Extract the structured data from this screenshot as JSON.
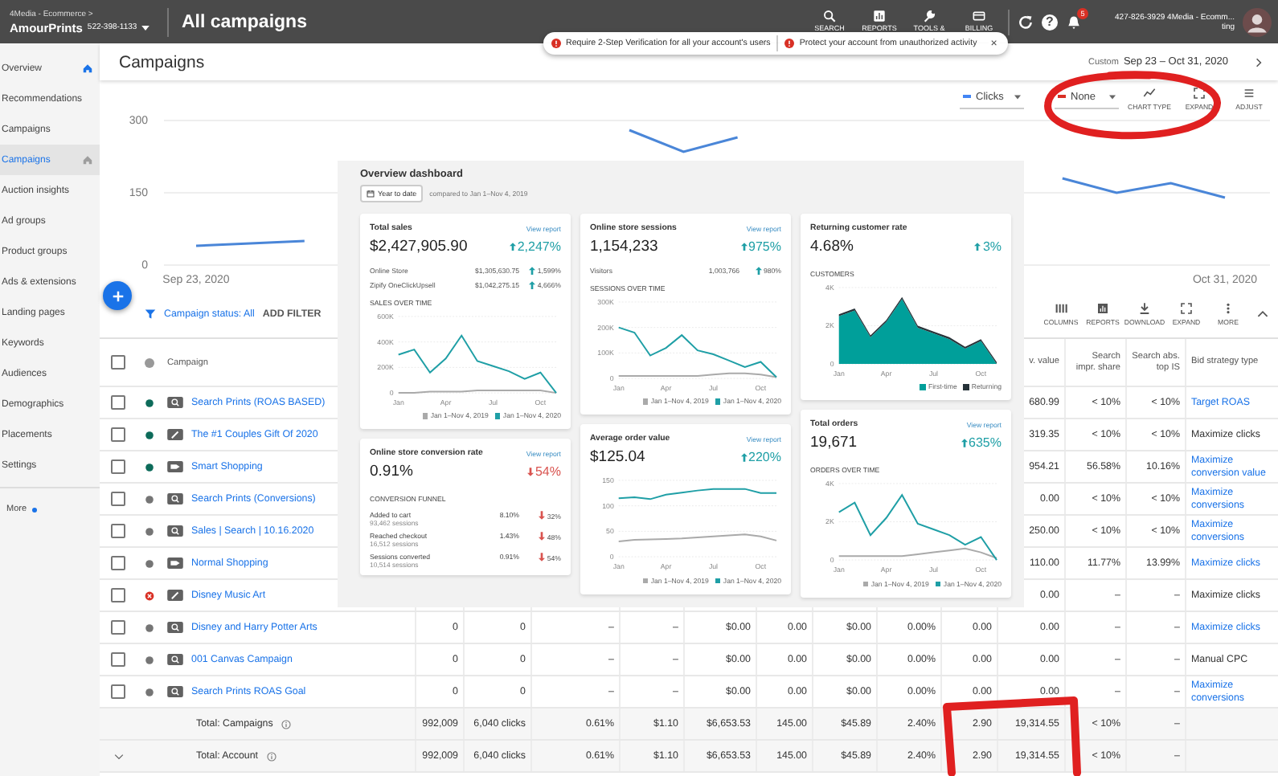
{
  "top_bar": {
    "breadcrumb": "4Media - Ecommerce >",
    "account_name": "AmourPrints",
    "account_id": "522-398-1133",
    "title": "All campaigns",
    "tools": [
      {
        "label": "SEARCH",
        "kind": "search"
      },
      {
        "label": "REPORTS",
        "kind": "reports"
      },
      {
        "label": "TOOLS &",
        "kind": "tools"
      },
      {
        "label": "BILLING",
        "kind": "billing"
      }
    ],
    "help": "?",
    "notification_count": "5",
    "account_line": "427-826-3929 4Media - Ecomm...",
    "account_line_2": "ting"
  },
  "alerts": {
    "items": [
      {
        "text": "Require 2-Step Verification for all your account's users"
      },
      {
        "text": "Protect your account from unauthorized activity"
      }
    ],
    "close": "×"
  },
  "sidebar": {
    "items": [
      {
        "label": "Overview",
        "selected": false,
        "home": true
      },
      {
        "label": "Recommendations",
        "selected": false,
        "home": false
      },
      {
        "label": "Campaigns",
        "selected": false,
        "home": false
      },
      {
        "label": "Campaigns",
        "selected": true,
        "home": true
      },
      {
        "label": "Auction insights",
        "selected": false,
        "home": false
      },
      {
        "label": "Ad groups",
        "selected": false,
        "home": false
      },
      {
        "label": "Product groups",
        "selected": false,
        "home": false
      },
      {
        "label": "Ads & extensions",
        "selected": false,
        "home": false
      },
      {
        "label": "Landing pages",
        "selected": false,
        "home": false
      },
      {
        "label": "Keywords",
        "selected": false,
        "home": false
      },
      {
        "label": "Audiences",
        "selected": false,
        "home": false
      },
      {
        "label": "Demographics",
        "selected": false,
        "home": false
      },
      {
        "label": "Placements",
        "selected": false,
        "home": false
      },
      {
        "label": "Settings",
        "selected": false,
        "home": false
      }
    ],
    "more": "More"
  },
  "page": {
    "title": "Campaigns",
    "date_prefix": "Custom",
    "date_range": "Sep 23 – Oct 31, 2020"
  },
  "chart_controls": {
    "metrics": [
      {
        "label": "Clicks",
        "color": "#4285f4"
      },
      {
        "label": "None",
        "color": "#d93025"
      }
    ],
    "actions": [
      {
        "label": "CHART TYPE",
        "kind": "chart"
      },
      {
        "label": "EXPAND",
        "kind": "expand"
      },
      {
        "label": "ADJUST",
        "kind": "adjust"
      }
    ]
  },
  "main_chart": {
    "chart_data": {
      "type": "line",
      "categories": [
        "Sep 23, 2020",
        null,
        null,
        null,
        null,
        null,
        null,
        null,
        null,
        null,
        null,
        null,
        null,
        null,
        null,
        null,
        null,
        null,
        null,
        "Oct 31, 2020"
      ],
      "ylim": [
        0,
        300
      ],
      "yticks": [
        0,
        150,
        300
      ],
      "series": [
        {
          "color": "#4a86d8",
          "values": [
            40,
            45,
            50,
            null,
            null,
            null,
            null,
            null,
            280,
            235,
            265,
            null,
            null,
            null,
            null,
            null,
            180,
            150,
            170,
            140
          ]
        }
      ]
    }
  },
  "filter": {
    "status": "Campaign status: All",
    "add": "ADD FILTER"
  },
  "table_tools": [
    {
      "label": "COLUMNS",
      "kind": "columns"
    },
    {
      "label": "REPORTS",
      "kind": "reports"
    },
    {
      "label": "DOWNLOAD",
      "kind": "download"
    },
    {
      "label": "EXPAND",
      "kind": "expand"
    },
    {
      "label": "MORE",
      "kind": "more"
    }
  ],
  "table": {
    "all_checked": false,
    "name_header": "Campaign",
    "columns": [
      "",
      "",
      "",
      "",
      "",
      "",
      "",
      "",
      "",
      "v. value",
      "Search impr. share",
      "Search abs. top IS",
      "Bid strategy type"
    ],
    "rows": [
      {
        "kind": "search",
        "name": "Search Prints (ROAS BASED)",
        "checked": false,
        "removed": false,
        "color": "#0d6b5a",
        "bid_link": true,
        "cells": [
          "680.99",
          "< 10%",
          "< 10%",
          "Target ROAS"
        ]
      },
      {
        "kind": "display",
        "name": "The #1 Couples Gift Of 2020",
        "checked": false,
        "removed": false,
        "color": "#0d6b5a",
        "bid_link": false,
        "cells": [
          "319.35",
          "< 10%",
          "< 10%",
          "Maximize clicks"
        ]
      },
      {
        "kind": "shopping",
        "name": "Smart Shopping",
        "checked": false,
        "removed": false,
        "color": "#0d6b5a",
        "bid_link": true,
        "cells": [
          "954.21",
          "56.58%",
          "10.16%",
          "Maximize conversion value"
        ]
      },
      {
        "kind": "search",
        "name": "Search Prints (Conversions)",
        "checked": false,
        "removed": false,
        "color": "#757575",
        "bid_link": true,
        "cells": [
          "0.00",
          "< 10%",
          "< 10%",
          "Maximize conversions"
        ]
      },
      {
        "kind": "search",
        "name": "Sales | Search | 10.16.2020",
        "checked": false,
        "removed": false,
        "color": "#757575",
        "bid_link": true,
        "cells": [
          "250.00",
          "< 10%",
          "< 10%",
          "Maximize conversions"
        ]
      },
      {
        "kind": "shopping",
        "name": "Normal Shopping",
        "checked": false,
        "removed": false,
        "color": "#757575",
        "bid_link": true,
        "cells": [
          "110.00",
          "11.77%",
          "13.99%",
          "Maximize clicks"
        ]
      },
      {
        "kind": "display",
        "name": "Disney Music Art",
        "checked": false,
        "removed": true,
        "color": "#d93025",
        "bid_link": false,
        "cells": [
          "0.00",
          "–",
          "–",
          "Maximize clicks"
        ]
      },
      {
        "kind": "search",
        "name": "Disney and Harry Potter Arts",
        "checked": false,
        "removed": false,
        "color": "#757575",
        "bid_link": true,
        "cells": [
          "0",
          "0",
          "–",
          "–",
          "$0.00",
          "0.00",
          "$0.00",
          "0.00%",
          "0.00",
          "0.00",
          "–",
          "–",
          "Maximize clicks"
        ]
      },
      {
        "kind": "search",
        "name": "001 Canvas Campaign",
        "checked": false,
        "removed": false,
        "color": "#757575",
        "bid_link": false,
        "cells": [
          "0",
          "0",
          "–",
          "–",
          "$0.00",
          "0.00",
          "$0.00",
          "0.00%",
          "0.00",
          "0.00",
          "–",
          "–",
          "Manual CPC"
        ]
      },
      {
        "kind": "search",
        "name": "Search Prints ROAS Goal",
        "checked": false,
        "removed": false,
        "color": "#757575",
        "bid_link": true,
        "cells": [
          "0",
          "0",
          "–",
          "–",
          "$0.00",
          "0.00",
          "$0.00",
          "0.00%",
          "0.00",
          "0.00",
          "–",
          "–",
          "Maximize conversions"
        ]
      },
      {
        "kind": "total",
        "name": "Total: Campaigns",
        "caret": false,
        "cells": [
          "992,009",
          "6,040 clicks",
          "0.61%",
          "$1.10",
          "$6,653.53",
          "145.00",
          "$45.89",
          "2.40%",
          "2.90",
          "19,314.55",
          "< 10%",
          "–"
        ]
      },
      {
        "kind": "total",
        "name": "Total: Account",
        "caret": true,
        "cells": [
          "992,009",
          "6,040 clicks",
          "0.61%",
          "$1.10",
          "$6,653.53",
          "145.00",
          "$45.89",
          "2.40%",
          "2.90",
          "19,314.55",
          "< 10%",
          "–"
        ]
      }
    ]
  },
  "dashboard": {
    "title": "Overview dashboard",
    "period": "Year to date",
    "comparison": "compared to Jan 1–Nov 4, 2019",
    "columns": [
      [
        {
          "kind": "chart",
          "title": "Total sales",
          "link": "View report",
          "value": "$2,427,905.90",
          "change": "2,247%",
          "increase": true,
          "breakdown": [
            {
              "label": "Online Store",
              "value": "$1,305,630.75",
              "change": "1,599%",
              "increase": true
            },
            {
              "label": "Zipify OneClickUpsell",
              "value": "$1,042,275.15",
              "change": "4,666%",
              "increase": true
            }
          ],
          "chart_title": "SALES OVER TIME",
          "chart_data": {
            "type": "line",
            "legend": "bottom-right",
            "categories": [
              "Jan",
              null,
              null,
              "Apr",
              null,
              null,
              "Jul",
              null,
              null,
              "Oct",
              null
            ],
            "ylim": [
              0,
              600
            ],
            "yticks": [
              {
                "value": 0,
                "label": "0"
              },
              {
                "value": 200,
                "label": "200K"
              },
              {
                "value": 400,
                "label": "400K"
              },
              {
                "value": 600,
                "label": "600K"
              }
            ],
            "series": [
              {
                "name": "Jan 1–Nov 4, 2019",
                "color": "#aaaaaa",
                "values": [
                  0,
                  0,
                  10,
                  10,
                  10,
                  20,
                  20,
                  20,
                  20,
                  20,
                  0
                ]
              },
              {
                "name": "Jan 1–Nov 4, 2020",
                "color": "#1f9fa6",
                "values": [
                  300,
                  340,
                  160,
                  270,
                  450,
                  250,
                  210,
                  170,
                  110,
                  160,
                  0
                ]
              }
            ]
          }
        },
        {
          "kind": "funnel",
          "title": "Online store conversion rate",
          "link": "View report",
          "value": "0.91%",
          "change": "54%",
          "increase": false,
          "funnel_title": "CONVERSION FUNNEL",
          "steps": [
            {
              "label": "Added to cart",
              "sessions": "93,462 sessions",
              "rate": "8.10%",
              "change": "32%",
              "increase": false
            },
            {
              "label": "Reached checkout",
              "sessions": "16,512 sessions",
              "rate": "1.43%",
              "change": "48%",
              "increase": false
            },
            {
              "label": "Sessions converted",
              "sessions": "10,514 sessions",
              "rate": "0.91%",
              "change": "54%",
              "increase": false
            }
          ]
        }
      ],
      [
        {
          "kind": "chart",
          "title": "Online store sessions",
          "link": "View report",
          "value": "1,154,233",
          "change": "975%",
          "increase": true,
          "breakdown": [
            {
              "label": "Visitors",
              "value": "1,003,766",
              "change": "980%",
              "increase": true
            }
          ],
          "chart_title": "SESSIONS OVER TIME",
          "chart_data": {
            "type": "line",
            "legend": "bottom-right",
            "categories": [
              "Jan",
              null,
              null,
              "Apr",
              null,
              null,
              "Jul",
              null,
              null,
              "Oct",
              null
            ],
            "ylim": [
              0,
              300
            ],
            "yticks": [
              {
                "value": 0,
                "label": "0"
              },
              {
                "value": 100,
                "label": "100K"
              },
              {
                "value": 200,
                "label": "200K"
              },
              {
                "value": 300,
                "label": "300K"
              }
            ],
            "series": [
              {
                "name": "Jan 1–Nov 4, 2019",
                "color": "#aaaaaa",
                "values": [
                  10,
                  10,
                  10,
                  10,
                  10,
                  10,
                  15,
                  20,
                  20,
                  15,
                  5
                ]
              },
              {
                "name": "Jan 1–Nov 4, 2020",
                "color": "#1f9fa6",
                "values": [
                  200,
                  180,
                  90,
                  120,
                  170,
                  110,
                  95,
                  70,
                  45,
                  65,
                  5
                ]
              }
            ]
          }
        },
        {
          "kind": "chart",
          "title": "Average order value",
          "link": "View report",
          "value": "$125.04",
          "change": "220%",
          "increase": true,
          "chart_data": {
            "type": "line",
            "legend": "bottom-right",
            "categories": [
              "Jan",
              null,
              null,
              "Apr",
              null,
              null,
              "Jul",
              null,
              null,
              "Oct",
              null
            ],
            "ylim": [
              0,
              150
            ],
            "yticks": [
              {
                "value": 0,
                "label": "0"
              },
              {
                "value": 50,
                "label": "50"
              },
              {
                "value": 100,
                "label": "100"
              },
              {
                "value": 150,
                "label": "150"
              }
            ],
            "series": [
              {
                "name": "Jan 1–Nov 4, 2019",
                "color": "#aaaaaa",
                "values": [
                  30,
                  33,
                  34,
                  35,
                  36,
                  38,
                  40,
                  42,
                  44,
                  40,
                  32
                ]
              },
              {
                "name": "Jan 1–Nov 4, 2020",
                "color": "#1f9fa6",
                "values": [
                  115,
                  117,
                  113,
                  122,
                  126,
                  130,
                  133,
                  133,
                  133,
                  125,
                  125
                ]
              }
            ]
          }
        }
      ],
      [
        {
          "kind": "chart",
          "title": "Returning customer rate",
          "value": "4.68%",
          "change": "3%",
          "increase": true,
          "chart_title": "CUSTOMERS",
          "chart_data": {
            "type": "area",
            "legend": "bottom-right",
            "stacked": true,
            "categories": [
              "Jan",
              null,
              null,
              "Apr",
              null,
              null,
              "Jul",
              null,
              null,
              "Oct",
              null
            ],
            "ylim": [
              0,
              4
            ],
            "yticks": [
              {
                "value": 0,
                "label": "0"
              },
              {
                "value": 2,
                "label": "2K"
              },
              {
                "value": 4,
                "label": "4K"
              }
            ],
            "series": [
              {
                "name": "First-time",
                "color": "#009f9a",
                "values": [
                  2.5,
                  2.8,
                  1.4,
                  2.2,
                  3.4,
                  1.9,
                  1.6,
                  1.3,
                  0.8,
                  1.2,
                  0
                ]
              },
              {
                "name": "Returning",
                "color": "#263238",
                "values": [
                  0.1,
                  0.1,
                  0.1,
                  0.1,
                  0.1,
                  0.1,
                  0.1,
                  0.1,
                  0.1,
                  0.1,
                  0.1
                ]
              }
            ]
          }
        },
        {
          "kind": "chart",
          "title": "Total orders",
          "link": "View report",
          "value": "19,671",
          "change": "635%",
          "increase": true,
          "chart_title": "ORDERS OVER TIME",
          "chart_data": {
            "type": "line",
            "legend": "bottom-right",
            "categories": [
              "Jan",
              null,
              null,
              "Apr",
              null,
              null,
              "Jul",
              null,
              null,
              "Oct",
              null
            ],
            "ylim": [
              0,
              4
            ],
            "yticks": [
              {
                "value": 0,
                "label": "0"
              },
              {
                "value": 2,
                "label": "2K"
              },
              {
                "value": 4,
                "label": "4K"
              }
            ],
            "series": [
              {
                "name": "Jan 1–Nov 4, 2019",
                "color": "#aaaaaa",
                "values": [
                  0.2,
                  0.2,
                  0.2,
                  0.2,
                  0.2,
                  0.3,
                  0.4,
                  0.5,
                  0.6,
                  0.4,
                  0.1
                ]
              },
              {
                "name": "Jan 1–Nov 4, 2020",
                "color": "#1f9fa6",
                "values": [
                  2.5,
                  3,
                  1.3,
                  2.2,
                  3.4,
                  1.9,
                  1.6,
                  1.3,
                  0.8,
                  1.2,
                  0
                ]
              }
            ]
          }
        }
      ]
    ]
  }
}
